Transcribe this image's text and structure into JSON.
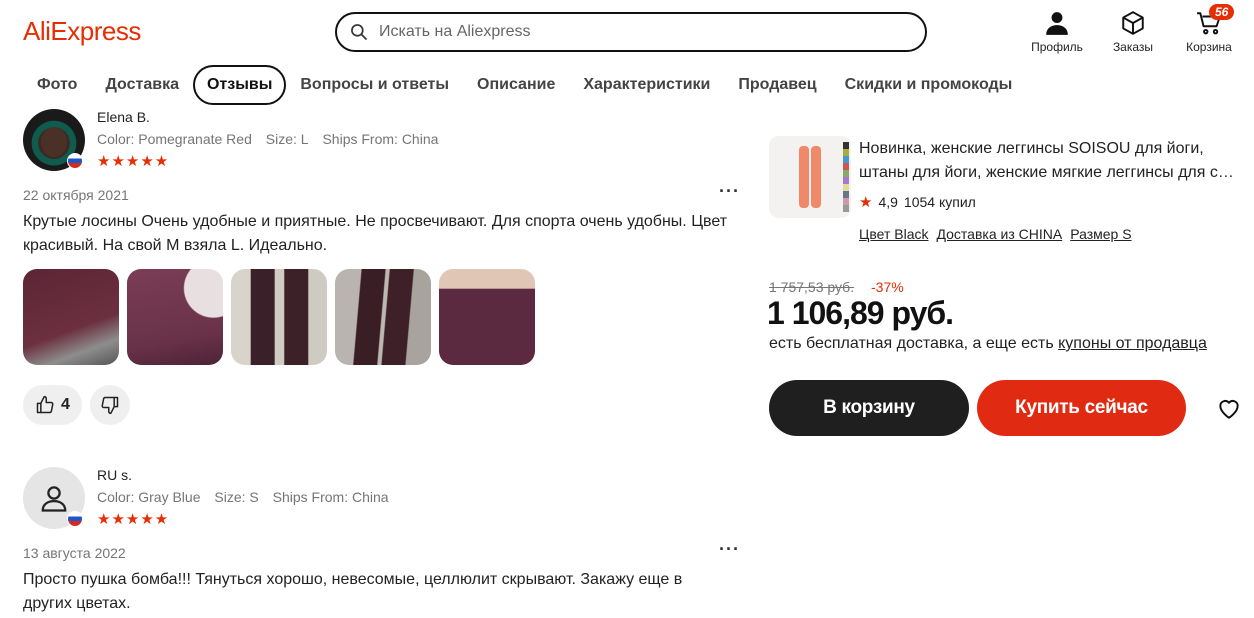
{
  "header": {
    "logo": "AliExpress",
    "search_placeholder": "Искать на Aliexpress",
    "profile_label": "Профиль",
    "orders_label": "Заказы",
    "cart_label": "Корзина",
    "cart_count": "56"
  },
  "tabs": [
    {
      "label": "Фото",
      "active": false
    },
    {
      "label": "Доставка",
      "active": false
    },
    {
      "label": "Отзывы",
      "active": true
    },
    {
      "label": "Вопросы и ответы",
      "active": false
    },
    {
      "label": "Описание",
      "active": false
    },
    {
      "label": "Характеристики",
      "active": false
    },
    {
      "label": "Продавец",
      "active": false
    },
    {
      "label": "Скидки и промокоды",
      "active": false
    }
  ],
  "reviews": [
    {
      "name": "Elena B.",
      "color": "Color: Pomegranate Red",
      "size": "Size: L",
      "ships": "Ships From: China",
      "stars": "★★★★★",
      "date": "22 октября 2021",
      "text": "Крутые лосины Очень удобные и приятные. Не просвечивают. Для спорта очень удобны. Цвет красивый. На свой М взяла L. Идеально.",
      "likes": "4",
      "more": "···"
    },
    {
      "name": "RU s.",
      "color": "Color: Gray Blue",
      "size": "Size: S",
      "ships": "Ships From: China",
      "stars": "★★★★★",
      "date": "13 августа 2022",
      "text": "Просто пушка бомба!!! Тянуться хорошо, невесомые, целлюлит скрывают. Закажу еще в других цветах.",
      "more": "···"
    }
  ],
  "product": {
    "title_line1": "Новинка, женские леггинсы SOISOU для йоги,",
    "title_line2": "штаны для йоги, женские мягкие леггинсы для спорта",
    "rating_star": "★",
    "rating": "4,9",
    "sold": "1054 купил",
    "opt_color": "Цвет Black",
    "opt_delivery": "Доставка из CHINA",
    "opt_size": "Размер S",
    "old_price": "1 757,53 руб.",
    "discount": "-37%",
    "price": "1 106,89 руб.",
    "delivery_text": "есть бесплатная доставка, а еще есть ",
    "delivery_link": "купоны от продавца",
    "add_to_cart": "В корзину",
    "buy_now": "Купить сейчас"
  },
  "colors": {
    "brand": "#e62e04",
    "buy_button": "#e02b12",
    "cart_button": "#1f1f1f"
  }
}
